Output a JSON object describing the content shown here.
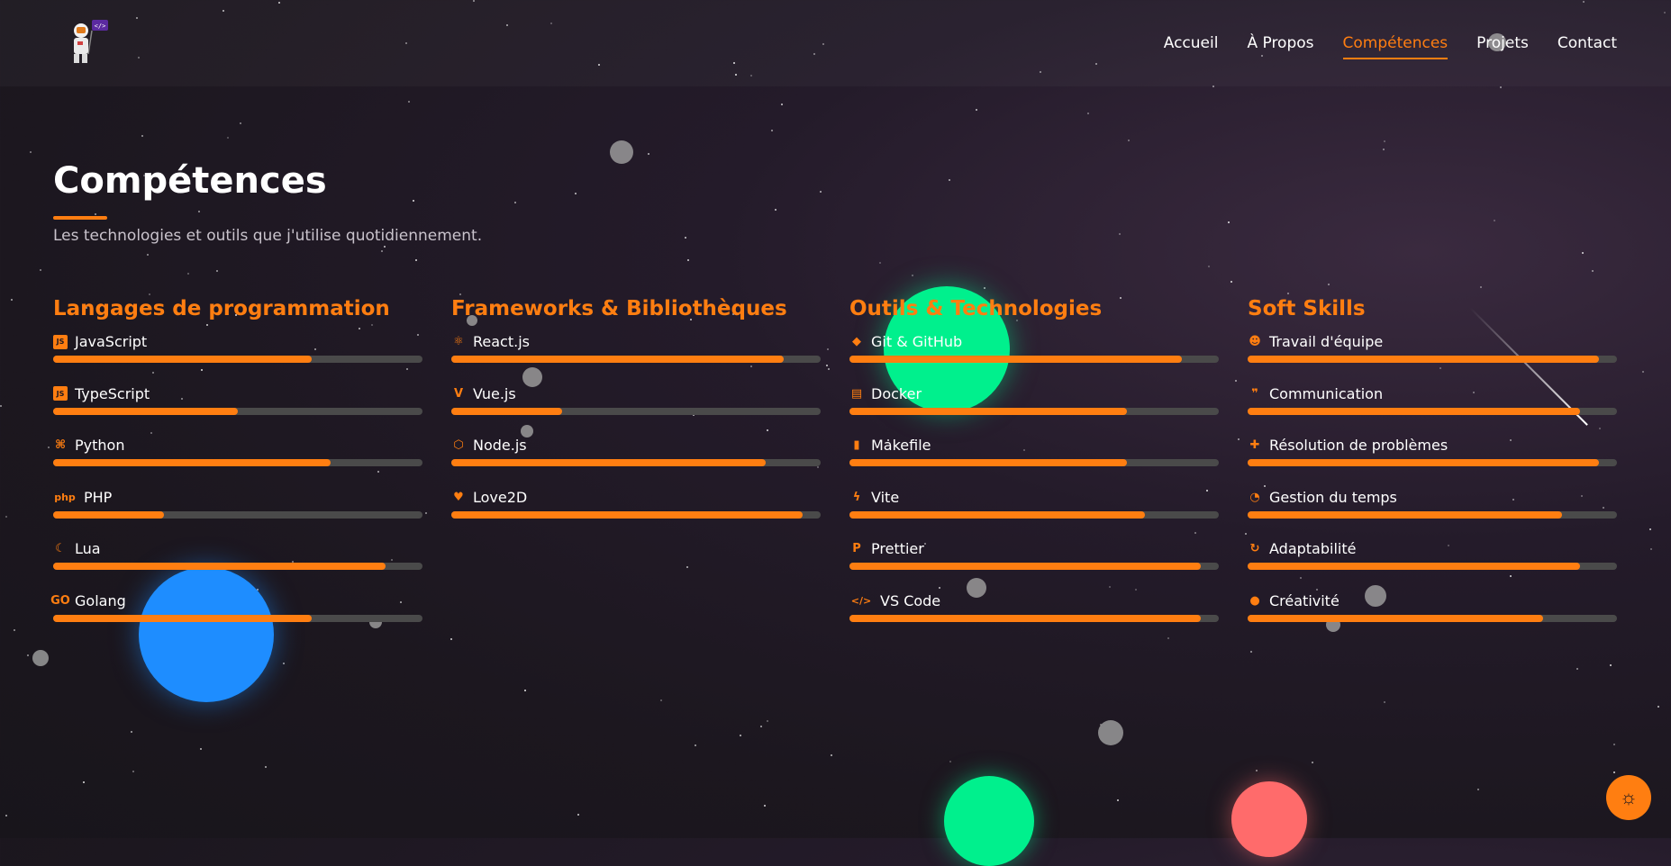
{
  "nav": {
    "items": [
      "Accueil",
      "À Propos",
      "Compétences",
      "Projets",
      "Contact"
    ],
    "active": "Compétences"
  },
  "hero": {
    "title": "Compétences",
    "subtitle": "Les technologies et outils que j'utilise quotidiennement."
  },
  "colors": {
    "accent": "#ff7e11",
    "track": "#4a4a4a"
  },
  "columns": [
    {
      "title": "Langages de programmation",
      "skills": [
        {
          "name": "JavaScript",
          "icon": "js-icon",
          "level": 0.7
        },
        {
          "name": "TypeScript",
          "icon": "ts-icon",
          "level": 0.5
        },
        {
          "name": "Python",
          "icon": "python-icon",
          "level": 0.75
        },
        {
          "name": "PHP",
          "icon": "php-icon",
          "level": 0.3
        },
        {
          "name": "Lua",
          "icon": "moon-icon",
          "level": 0.9
        },
        {
          "name": "Golang",
          "icon": "go-icon",
          "level": 0.7
        }
      ]
    },
    {
      "title": "Frameworks & Bibliothèques",
      "skills": [
        {
          "name": "React.js",
          "icon": "react-icon",
          "level": 0.9
        },
        {
          "name": "Vue.js",
          "icon": "vue-icon",
          "level": 0.3
        },
        {
          "name": "Node.js",
          "icon": "node-icon",
          "level": 0.85
        },
        {
          "name": "Love2D",
          "icon": "heart-icon",
          "level": 0.95
        }
      ]
    },
    {
      "title": "Outils & Technologies",
      "skills": [
        {
          "name": "Git & GitHub",
          "icon": "git-icon",
          "level": 0.9
        },
        {
          "name": "Docker",
          "icon": "docker-icon",
          "level": 0.75
        },
        {
          "name": "Makefile",
          "icon": "file-icon",
          "level": 0.75
        },
        {
          "name": "Vite",
          "icon": "bolt-icon",
          "level": 0.8
        },
        {
          "name": "Prettier",
          "icon": "prettier-icon",
          "level": 0.95
        },
        {
          "name": "VS Code",
          "icon": "code-icon",
          "level": 0.95
        }
      ]
    },
    {
      "title": "Soft Skills",
      "skills": [
        {
          "name": "Travail d'équipe",
          "icon": "users-icon",
          "level": 0.95
        },
        {
          "name": "Communication",
          "icon": "chat-icon",
          "level": 0.9
        },
        {
          "name": "Résolution de problèmes",
          "icon": "puzzle-icon",
          "level": 0.95
        },
        {
          "name": "Gestion du temps",
          "icon": "clock-icon",
          "level": 0.85
        },
        {
          "name": "Adaptabilité",
          "icon": "refresh-icon",
          "level": 0.9
        },
        {
          "name": "Créativité",
          "icon": "lightbulb-icon",
          "level": 0.8
        }
      ]
    }
  ]
}
